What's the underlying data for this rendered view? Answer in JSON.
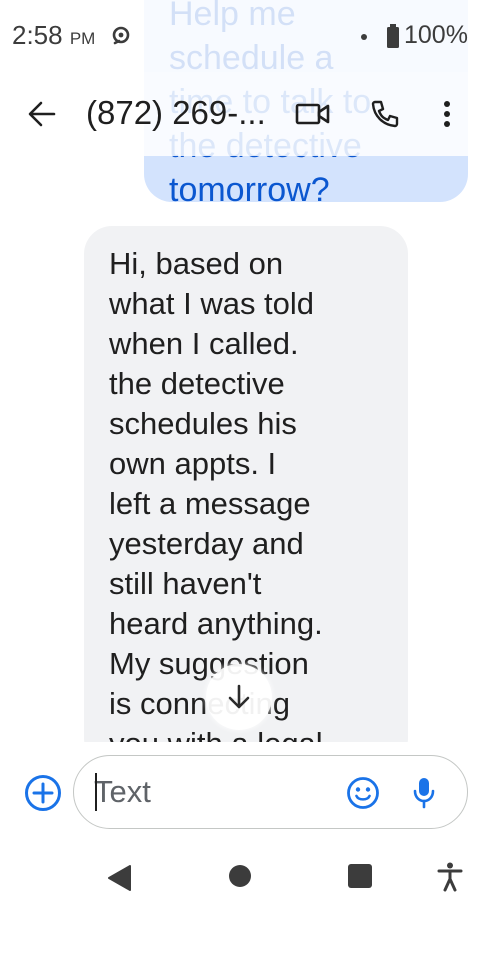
{
  "status_bar": {
    "time": "2:58",
    "ampm": "PM",
    "battery_percent": "100%",
    "icons": [
      "notification-icon",
      "dot-icon",
      "battery-icon"
    ]
  },
  "app_bar": {
    "contact_title": "(872) 269-...",
    "icons": [
      "back-arrow-icon",
      "video-call-icon",
      "phone-icon",
      "more-vert-icon"
    ]
  },
  "messages": [
    {
      "direction": "sent",
      "text": "Help me\nschedule a\ntime to talk to\nthe detective\ntomorrow?"
    },
    {
      "direction": "received",
      "text": "Hi, based on\nwhat I was told\nwhen I called.\nthe detective\nschedules his\nown appts. I\nleft a message\nyesterday and\nstill haven't\nheard anything.\nMy suggestion\nis connecting\nyou with a legal"
    }
  ],
  "compose": {
    "placeholder": "Text",
    "value": "",
    "icons": [
      "add-circle-icon",
      "emoji-icon",
      "microphone-icon"
    ]
  },
  "nav_bar": {
    "icons": [
      "back-triangle-icon",
      "home-circle-icon",
      "recents-square-icon",
      "accessibility-icon"
    ]
  },
  "colors": {
    "sent_bubble_bg": "#d3e3fd",
    "sent_text": "#0b57d0",
    "received_bubble_bg": "#f1f2f4",
    "accent": "#1a73e8",
    "icon_gray": "#3c3c3c"
  }
}
